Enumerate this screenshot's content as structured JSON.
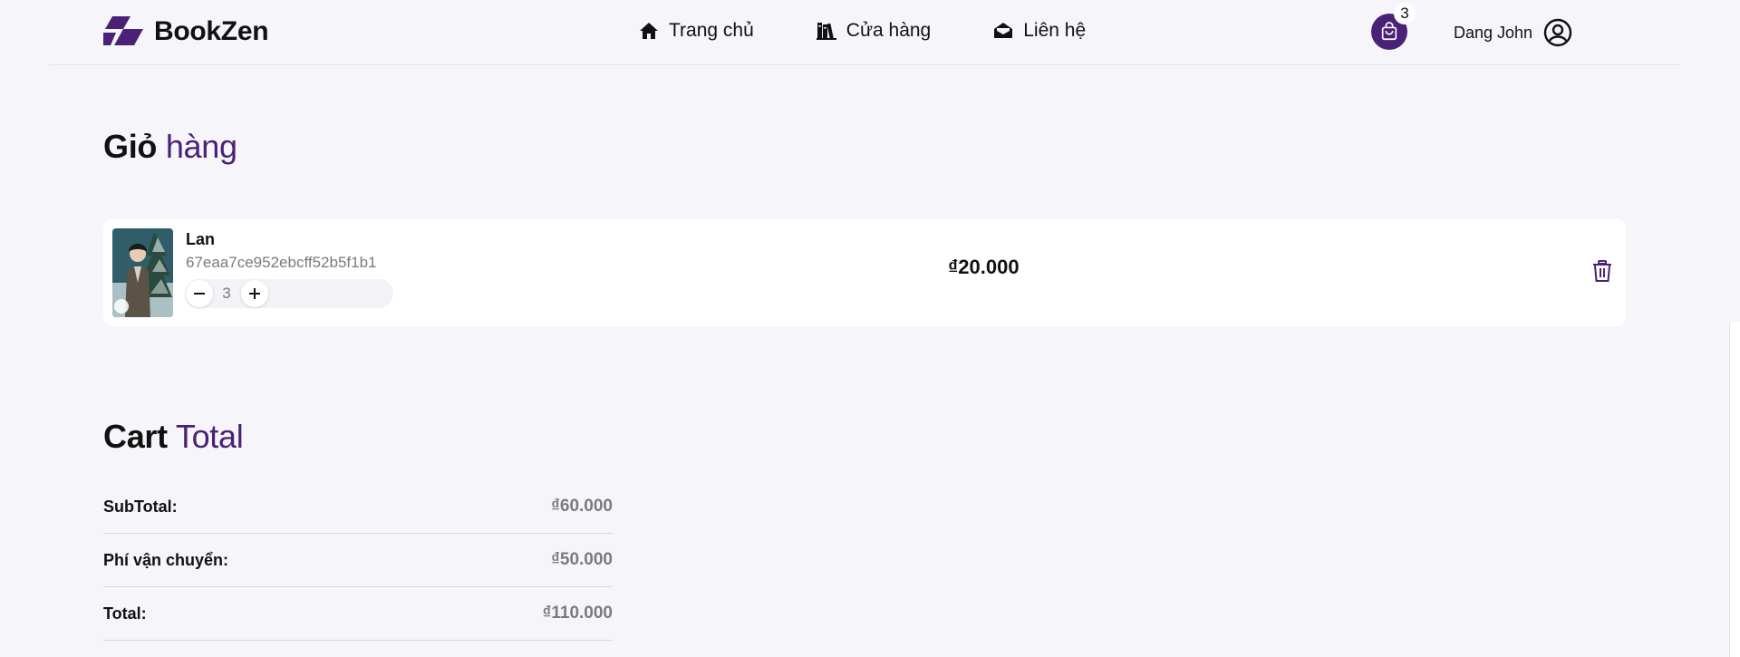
{
  "brand": {
    "name": "BookZen",
    "accent": "#4b2177"
  },
  "nav": {
    "items": [
      {
        "label": "Trang chủ",
        "icon": "home-icon"
      },
      {
        "label": "Cửa hàng",
        "icon": "books-icon"
      },
      {
        "label": "Liên hệ",
        "icon": "envelope-icon"
      }
    ]
  },
  "header": {
    "cart_count": "3",
    "user_name": "Dang John"
  },
  "cart": {
    "title_bold": "Giỏ",
    "title_light": "hàng",
    "items": [
      {
        "name": "Lan",
        "id": "67eaa7ce952ebcff52b5f1b1",
        "quantity": "3",
        "price": "₫20.000"
      }
    ]
  },
  "totals": {
    "title_bold": "Cart",
    "title_light": "Total",
    "rows": [
      {
        "label": "SubTotal:",
        "value": "₫60.000"
      },
      {
        "label": "Phí vận chuyển:",
        "value": "₫50.000"
      },
      {
        "label": "Total:",
        "value": "₫110.000"
      }
    ]
  }
}
